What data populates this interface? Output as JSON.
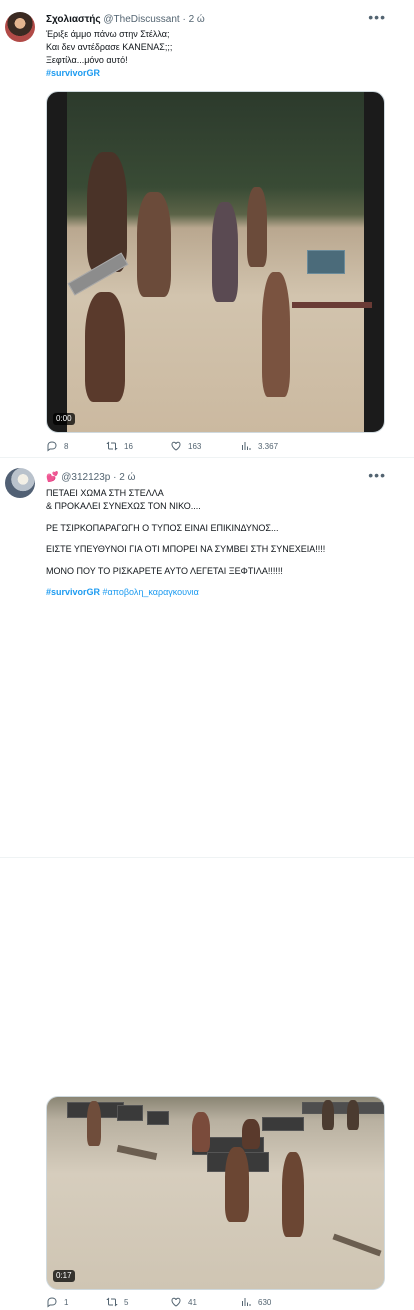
{
  "tweets": [
    {
      "name": "Σχολιαστής",
      "handle": "@TheDiscussant",
      "time": "2 ώ",
      "lines": [
        "Έριξε άμμο πάνω στην Στέλλα;",
        "Και δεν αντέδρασε ΚΑΝΕΝΑΣ;;;",
        "Ξεφτίλα...μόνο αυτό!"
      ],
      "hashtag": "#survivorGR",
      "video_time": "0:00",
      "replies": "8",
      "retweets": "16",
      "likes": "163",
      "views": "3.367"
    },
    {
      "name": "",
      "handle": "@312123p",
      "time": "2 ώ",
      "lines": [
        "ΠΕΤΑΕΙ ΧΩΜΑ ΣΤΗ ΣΤΕΛΛΑ",
        "& ΠΡΟΚΑΛΕΙ ΣΥΝΕΧΩΣ ΤΟΝ ΝΙΚΟ....",
        "ΡΕ ΤΣΙΡΚΟΠΑΡΑΓΩΓΗ Ο ΤΥΠΟΣ ΕΙΝΑΙ ΕΠΙΚΙΝΔΥΝΟΣ...",
        "ΕΙΣΤΕ ΥΠΕΥΘΥΝΟΙ ΓΙΑ ΟΤΙ ΜΠΟΡΕΙ ΝΑ ΣΥΜΒΕΙ ΣΤΗ ΣΥΝΕΧΕΙΑ!!!!",
        "ΜΟΝΟ ΠΟΥ ΤΟ ΡΙΣΚΑΡΕΤΕ ΑΥΤΟ ΛΕΓΕΤΑΙ ΞΕΦΤΙΛΑ!!!!!!"
      ],
      "hashtag": "#survivorGR",
      "hashtag2": "#αποβολη_καραγκουνια",
      "video_time": "0:17",
      "replies": "1",
      "retweets": "5",
      "likes": "41",
      "views": "630"
    }
  ],
  "icons": [
    "hearts-emoji-icon",
    "more-icon",
    "reply-icon",
    "retweet-icon",
    "like-icon",
    "views-icon"
  ],
  "colors": {
    "link": "#1d9bf0",
    "secondary": "#536471",
    "heart_emoji": "#d61f4f"
  }
}
